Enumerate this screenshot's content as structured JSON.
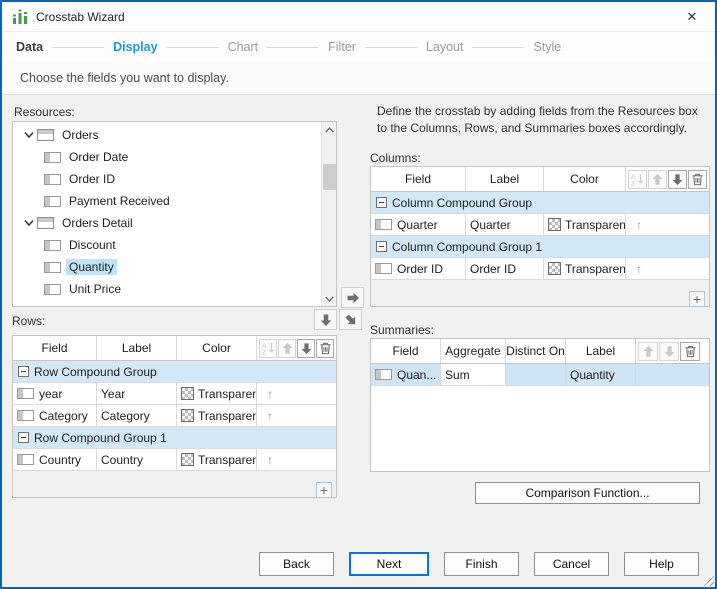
{
  "window": {
    "title": "Crosstab Wizard",
    "close_glyph": "✕"
  },
  "steps": {
    "items": [
      {
        "label": "Data",
        "state": "done"
      },
      {
        "label": "Display",
        "state": "active"
      },
      {
        "label": "Chart",
        "state": "todo"
      },
      {
        "label": "Filter",
        "state": "todo"
      },
      {
        "label": "Layout",
        "state": "todo"
      },
      {
        "label": "Style",
        "state": "todo"
      }
    ],
    "subtitle": "Choose the fields you want to display."
  },
  "instruction": "Define the crosstab by adding fields from the Resources box to the Columns, Rows, and Summaries boxes accordingly.",
  "resources": {
    "label": "Resources:",
    "tree": [
      {
        "label": "Orders",
        "type": "table",
        "expanded": true
      },
      {
        "label": "Order Date",
        "type": "field"
      },
      {
        "label": "Order ID",
        "type": "field"
      },
      {
        "label": "Payment Received",
        "type": "field"
      },
      {
        "label": "Orders Detail",
        "type": "table",
        "expanded": true
      },
      {
        "label": "Discount",
        "type": "field"
      },
      {
        "label": "Quantity",
        "type": "field",
        "selected": true
      },
      {
        "label": "Unit Price",
        "type": "field"
      }
    ]
  },
  "columns": {
    "label": "Columns:",
    "headers": {
      "field": "Field",
      "label": "Label",
      "color": "Color"
    },
    "rows": [
      {
        "kind": "group",
        "title": "Column Compound Group"
      },
      {
        "kind": "field",
        "field": "Quarter",
        "label": "Quarter",
        "color": "Transparent"
      },
      {
        "kind": "group",
        "title": "Column Compound Group 1"
      },
      {
        "kind": "field",
        "field": "Order ID",
        "label": "Order ID",
        "color": "Transparent"
      }
    ]
  },
  "rows": {
    "label": "Rows:",
    "headers": {
      "field": "Field",
      "label": "Label",
      "color": "Color"
    },
    "rows": [
      {
        "kind": "group",
        "title": "Row Compound Group"
      },
      {
        "kind": "field",
        "field": "year",
        "label": "Year",
        "color": "Transparent"
      },
      {
        "kind": "field",
        "field": "Category",
        "label": "Category",
        "color": "Transparent"
      },
      {
        "kind": "group",
        "title": "Row Compound Group 1"
      },
      {
        "kind": "field",
        "field": "Country",
        "label": "Country",
        "color": "Transparent"
      }
    ]
  },
  "summaries": {
    "label": "Summaries:",
    "headers": {
      "field": "Field",
      "aggregate": "Aggregate",
      "distinct_on": "Distinct On",
      "label": "Label"
    },
    "rows": [
      {
        "field": "Quan...",
        "aggregate": "Sum",
        "distinct_on": "",
        "label": "Quantity",
        "selected": true
      }
    ]
  },
  "buttons": {
    "comparison": "Comparison Function...",
    "back": "Back",
    "next": "Next",
    "finish": "Finish",
    "cancel": "Cancel",
    "help": "Help"
  },
  "colors": {
    "window_border": "#0067c0",
    "active_step": "#1a9ad6",
    "group_row_bg": "#d2e8f7",
    "selection_bg": "#bfe3f7",
    "title_icon_green": "#43a047"
  }
}
